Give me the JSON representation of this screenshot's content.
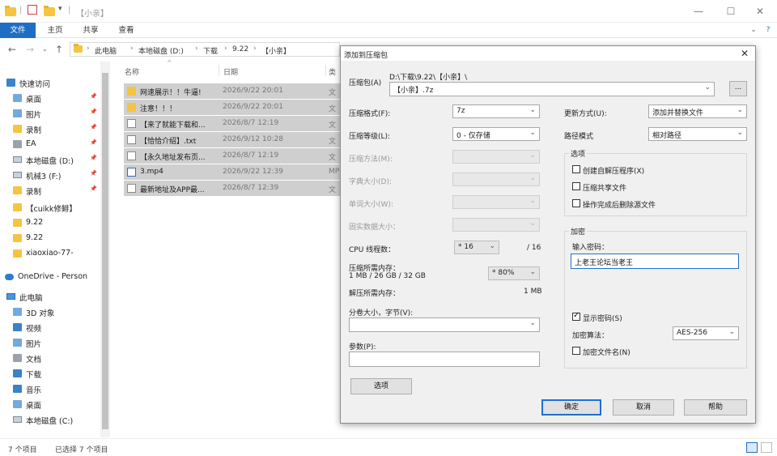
{
  "explorer": {
    "title": "【小亲】",
    "ribbon_tabs": [
      "文件",
      "主页",
      "共享",
      "查看"
    ],
    "breadcrumbs": [
      "此电脑",
      "本地磁盘 (D:)",
      "下载",
      "9.22",
      "【小亲】"
    ],
    "nav_items": [
      {
        "label": "快速访问",
        "icon": "star-icon",
        "pinned": false
      },
      {
        "label": "桌面",
        "icon": "desktop-icon",
        "pinned": true
      },
      {
        "label": "图片",
        "icon": "pictures-icon",
        "pinned": true
      },
      {
        "label": "录制",
        "icon": "folder-icon",
        "pinned": true
      },
      {
        "label": "EA",
        "icon": "network-drive-icon",
        "pinned": true
      },
      {
        "label": "本地磁盘 (D:)",
        "icon": "drive-icon",
        "pinned": true
      },
      {
        "label": "机械3 (F:)",
        "icon": "drive-icon",
        "pinned": true
      },
      {
        "label": "录制",
        "icon": "folder-icon",
        "pinned": true
      },
      {
        "label": "【cuikk修鲱】",
        "icon": "folder-icon",
        "pinned": false
      },
      {
        "label": "9.22",
        "icon": "folder-icon",
        "pinned": false
      },
      {
        "label": "9.22",
        "icon": "folder-icon",
        "pinned": false
      },
      {
        "label": "xiaoxiao-77-",
        "icon": "folder-icon",
        "pinned": false
      },
      {
        "label": "OneDrive - Person",
        "icon": "cloud-icon",
        "pinned": false
      },
      {
        "label": "此电脑",
        "icon": "pc-icon",
        "pinned": false
      },
      {
        "label": "3D 对象",
        "icon": "cube-icon",
        "pinned": false
      },
      {
        "label": "视频",
        "icon": "video-icon",
        "pinned": false
      },
      {
        "label": "图片",
        "icon": "pictures-icon",
        "pinned": false
      },
      {
        "label": "文档",
        "icon": "documents-icon",
        "pinned": false
      },
      {
        "label": "下载",
        "icon": "download-icon",
        "pinned": false
      },
      {
        "label": "音乐",
        "icon": "music-icon",
        "pinned": false
      },
      {
        "label": "桌面",
        "icon": "desktop-icon",
        "pinned": false
      },
      {
        "label": "本地磁盘 (C:)",
        "icon": "drive-icon",
        "pinned": false
      }
    ],
    "columns": [
      "名称",
      "日期",
      "类"
    ],
    "files": [
      {
        "name": "网速展示！！牛逼!",
        "date": "2026/9/22 20:01",
        "type": "文",
        "kind": "folder"
      },
      {
        "name": "注意！！！",
        "date": "2026/9/22 20:01",
        "type": "文",
        "kind": "folder"
      },
      {
        "name": "【来了就能下载和...",
        "date": "2026/8/7 12:19",
        "type": "文",
        "kind": "doc"
      },
      {
        "name": "【恰恰介绍】.txt",
        "date": "2026/9/12 10:28",
        "type": "文",
        "kind": "doc"
      },
      {
        "name": "【永久地址发布页...",
        "date": "2026/8/7 12:19",
        "type": "文",
        "kind": "doc"
      },
      {
        "name": "3.mp4",
        "date": "2026/9/22 12:39",
        "type": "MP",
        "kind": "video"
      },
      {
        "name": "最新地址及APP最...",
        "date": "2026/8/7 12:39",
        "type": "文",
        "kind": "doc"
      }
    ],
    "status": {
      "count": "7 个项目",
      "selected": "已选择 7 个项目"
    }
  },
  "dialog": {
    "title": "添加到压缩包",
    "archive": {
      "label": "压缩包(A)",
      "path": "D:\\下载\\9.22\\【小亲】\\",
      "value": "【小亲】.7z",
      "browse": "..."
    },
    "left": [
      {
        "label": "压缩格式(F):",
        "value": "7z",
        "disabled": false
      },
      {
        "label": "压缩等级(L):",
        "value": "0 - 仅存储",
        "disabled": false
      },
      {
        "label": "压缩方法(M):",
        "value": "",
        "disabled": true
      },
      {
        "label": "字典大小(D):",
        "value": "",
        "disabled": true
      },
      {
        "label": "单词大小(W):",
        "value": "",
        "disabled": true
      },
      {
        "label": "固实数据大小：",
        "value": "",
        "disabled": true
      }
    ],
    "cpu": {
      "label": "CPU 线程数：",
      "value": "* 16",
      "total": "/ 16"
    },
    "mem_compress": {
      "label": "压缩所需内存：",
      "detail": "1 MB / 26 GB / 32 GB",
      "value": "* 80%"
    },
    "mem_decompress": {
      "label": "解压所需内存：",
      "value": "1 MB"
    },
    "split": {
      "label": "分卷大小，字节(V):",
      "value": ""
    },
    "params": {
      "label": "参数(P):",
      "value": ""
    },
    "options_button": "选项",
    "right": {
      "update_mode": {
        "label": "更新方式(U):",
        "value": "添加并替换文件"
      },
      "path_mode": {
        "label": "路径模式",
        "value": "相对路径"
      },
      "options_group": "选项",
      "options": [
        {
          "label": "创建自解压程序(X)",
          "checked": false
        },
        {
          "label": "压缩共享文件",
          "checked": false
        },
        {
          "label": "操作完成后删除源文件",
          "checked": false
        }
      ],
      "encryption_group": "加密",
      "password_label": "输入密码：",
      "password_value": "上老王论坛当老王",
      "show_password": {
        "label": "显示密码(S)",
        "checked": true
      },
      "algorithm": {
        "label": "加密算法：",
        "value": "AES-256"
      },
      "encrypt_names": {
        "label": "加密文件名(N)",
        "checked": false
      }
    },
    "buttons": {
      "ok": "确定",
      "cancel": "取消",
      "help": "帮助"
    }
  }
}
